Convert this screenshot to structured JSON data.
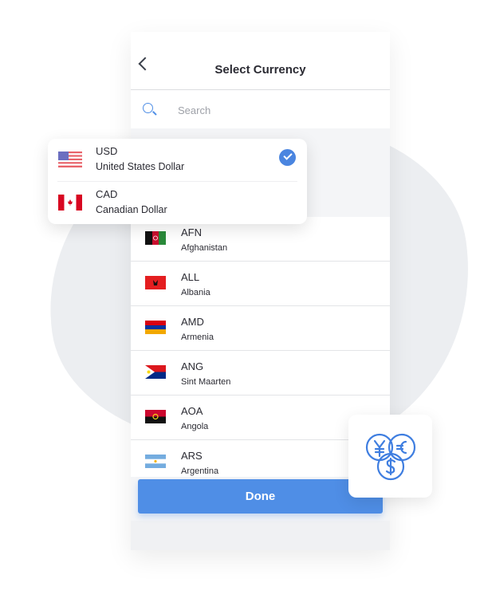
{
  "header": {
    "title": "Select Currency"
  },
  "search": {
    "placeholder": "Search"
  },
  "selected": [
    {
      "code": "USD",
      "name": "United States Dollar",
      "checked": true
    },
    {
      "code": "CAD",
      "name": "Canadian Dollar",
      "checked": false
    }
  ],
  "currencies": [
    {
      "code": "AFN",
      "name": "Afghanistan"
    },
    {
      "code": "ALL",
      "name": "Albania"
    },
    {
      "code": "AMD",
      "name": "Armenia"
    },
    {
      "code": "ANG",
      "name": "Sint Maarten"
    },
    {
      "code": "AOA",
      "name": "Angola"
    },
    {
      "code": "ARS",
      "name": "Argentina"
    }
  ],
  "done_label": "Done",
  "colors": {
    "accent": "#4f8ee6"
  },
  "icons": {
    "badge": "currency-exchange-icon"
  }
}
